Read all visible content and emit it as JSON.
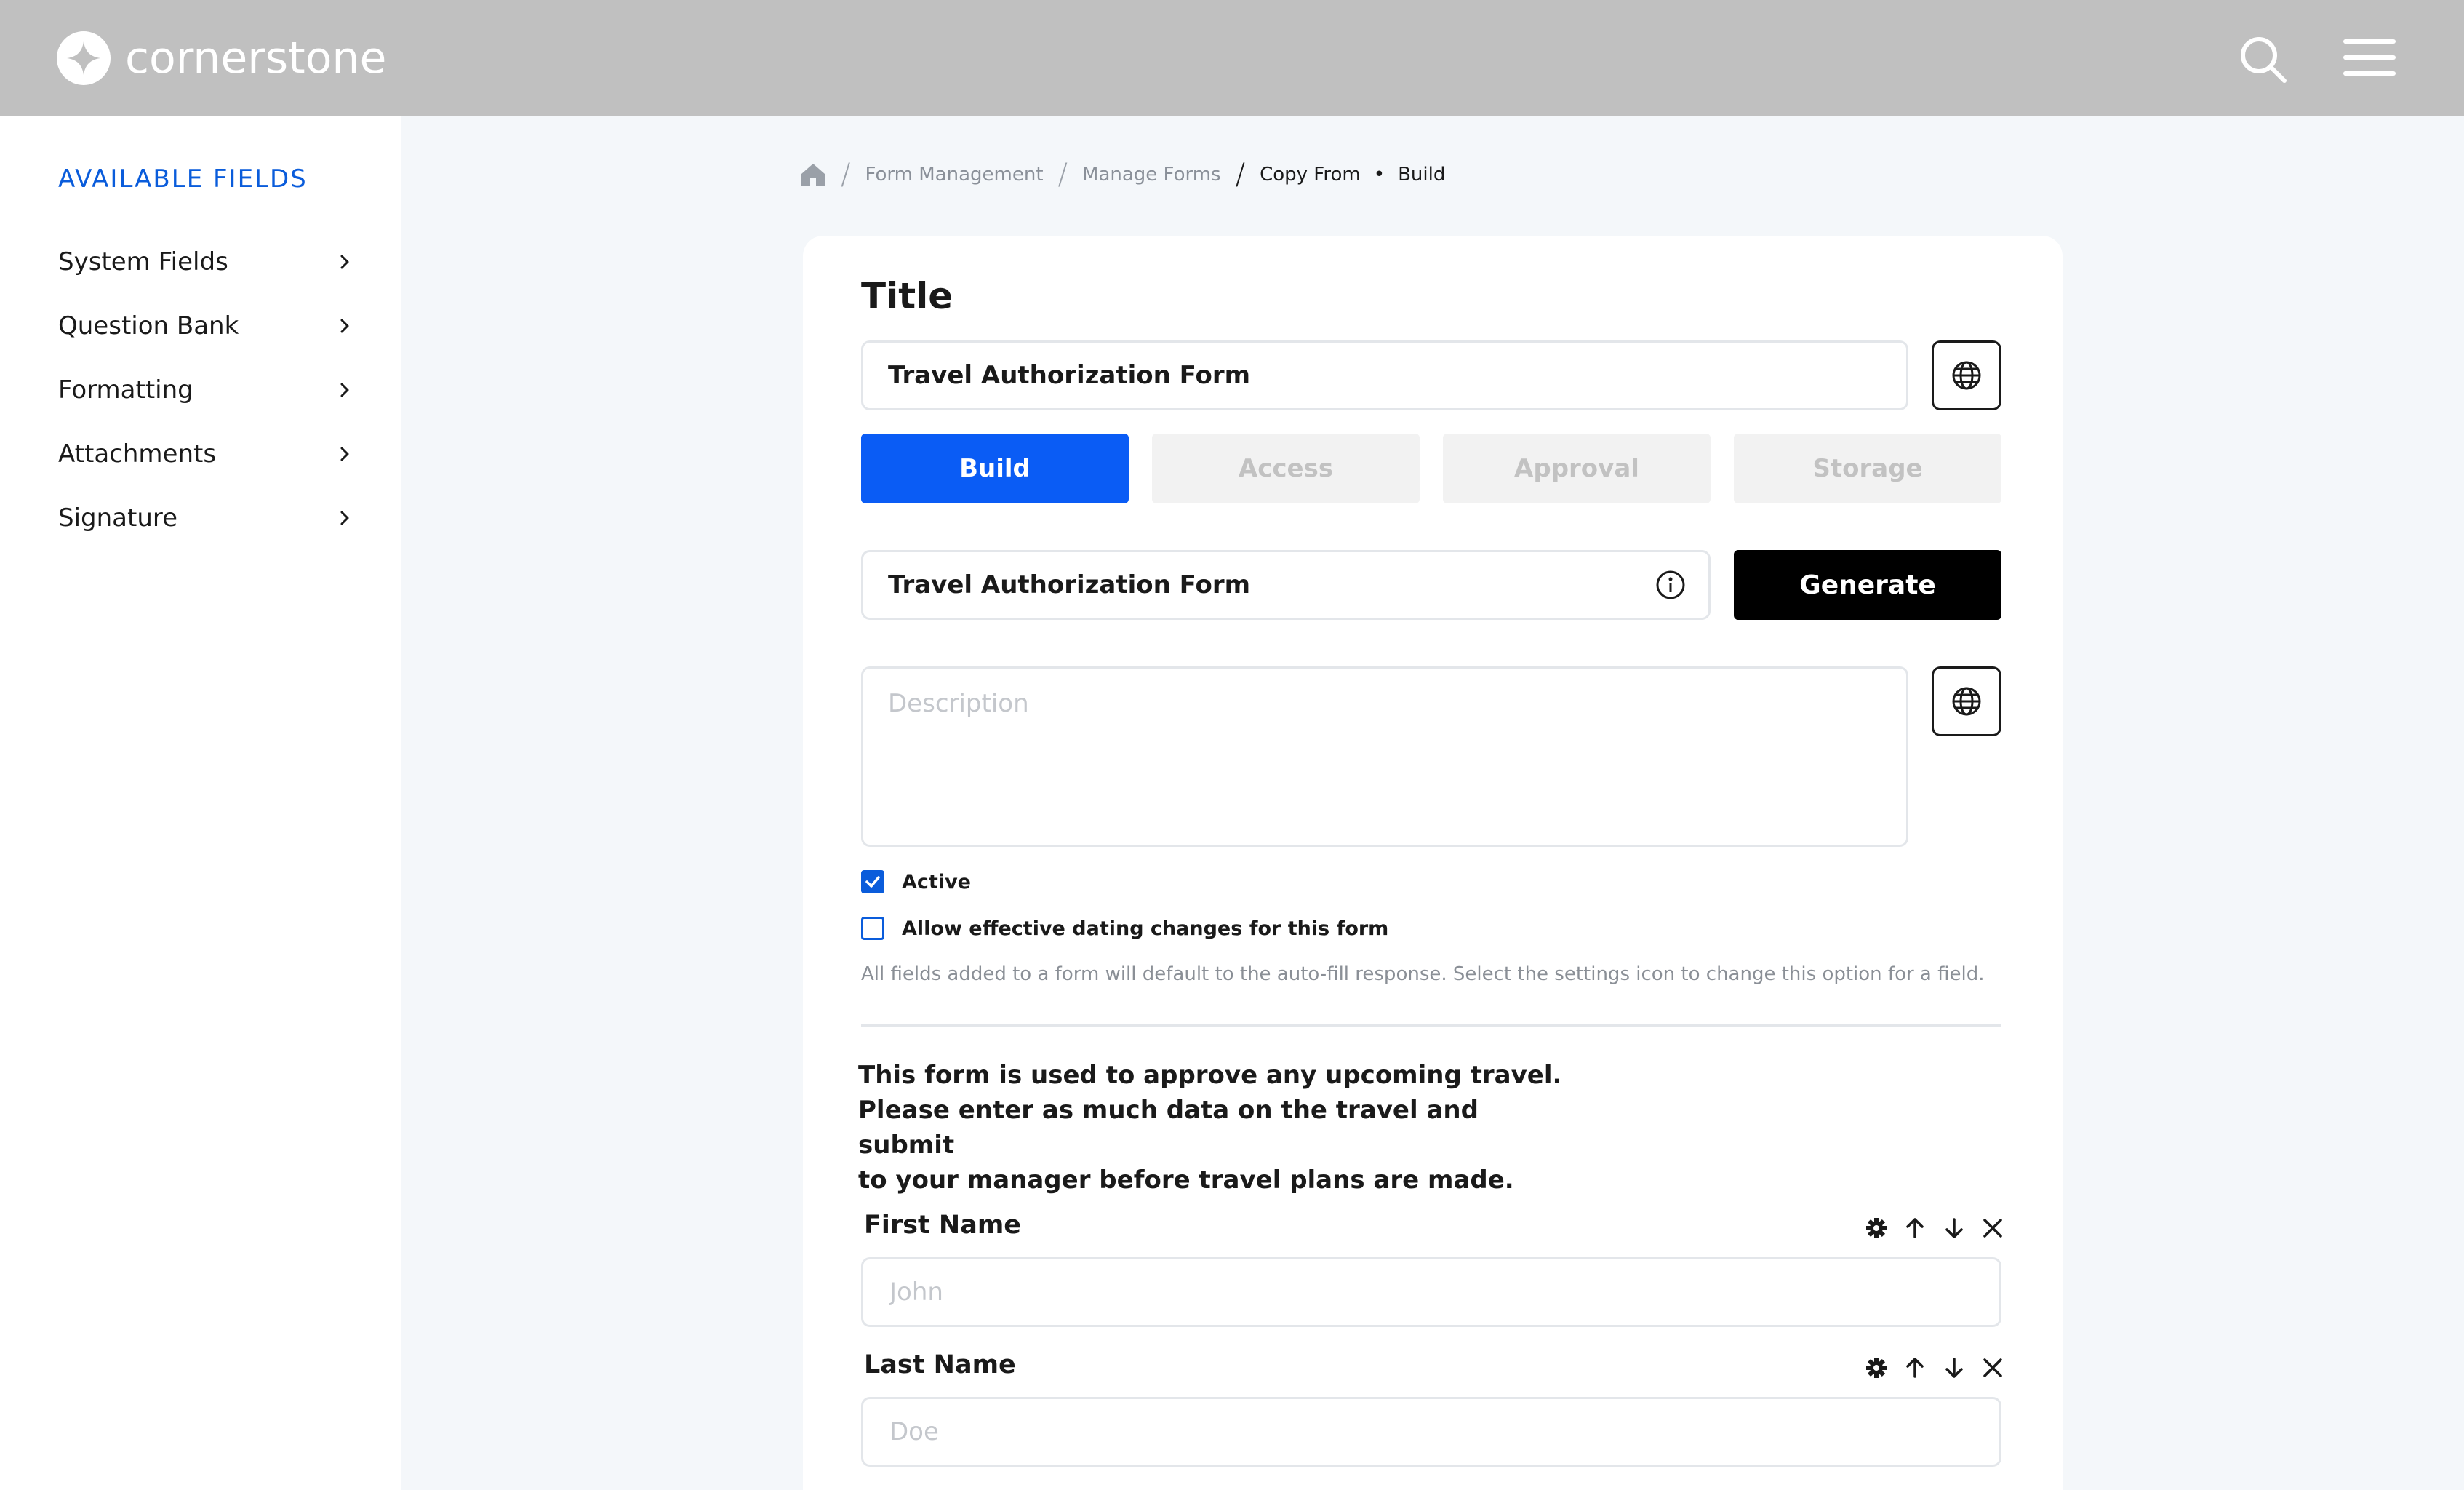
{
  "header": {
    "brand": "cornerstone",
    "search_icon": "search-icon",
    "menu_icon": "hamburger-menu-icon"
  },
  "sidebar": {
    "title": "AVAILABLE FIELDS",
    "items": [
      {
        "label": "System Fields"
      },
      {
        "label": "Question Bank"
      },
      {
        "label": "Formatting"
      },
      {
        "label": "Attachments"
      },
      {
        "label": "Signature"
      }
    ]
  },
  "breadcrumb": {
    "items": [
      "Form Management",
      "Manage Forms",
      "Copy From"
    ],
    "current": "Build"
  },
  "form": {
    "title_label": "Title",
    "title_value": "Travel Authorization Form",
    "tabs": [
      {
        "label": "Build",
        "active": true
      },
      {
        "label": "Access",
        "active": false
      },
      {
        "label": "Approval",
        "active": false
      },
      {
        "label": "Storage",
        "active": false
      }
    ],
    "generate_input_value": "Travel Authorization Form",
    "generate_label": "Generate",
    "description_placeholder": "Description",
    "active_label": "Active",
    "active_checked": true,
    "effective_dating_label": "Allow effective dating changes for this form",
    "effective_dating_checked": false,
    "note": "All fields added to a form will default to the auto-fill response. Select the settings icon to change this option for a field.",
    "intro_lines": [
      "This form is used to approve any upcoming travel.",
      "Please enter as much data on the travel and submit",
      "to your manager before travel plans are made."
    ],
    "fields": [
      {
        "label": "First Name",
        "placeholder": "John"
      },
      {
        "label": "Last Name",
        "placeholder": "Doe"
      }
    ]
  },
  "colors": {
    "primary": "#0a5cf5",
    "link": "#0a5cdb",
    "header_bg": "#c0c0c0",
    "page_bg": "#f4f7fa"
  }
}
